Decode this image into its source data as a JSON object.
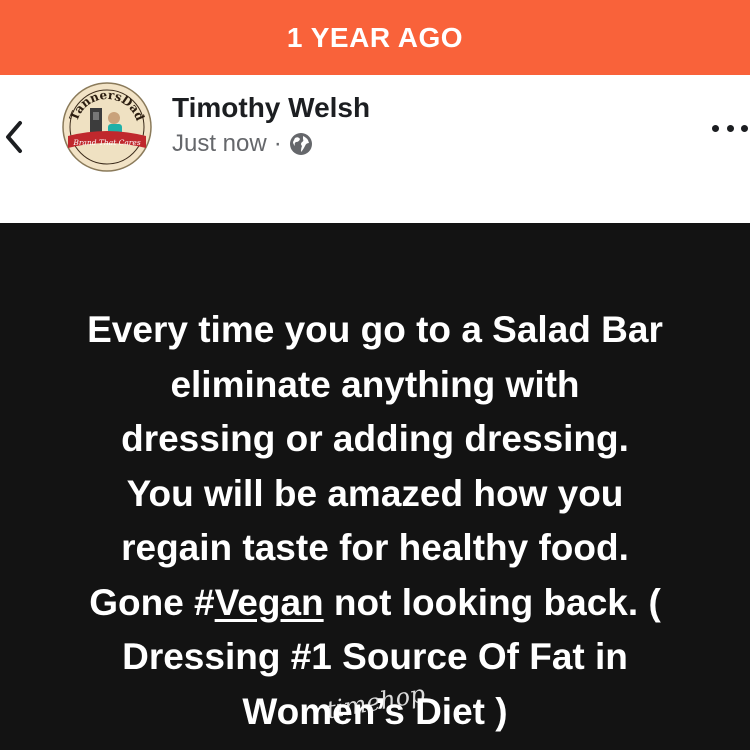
{
  "banner": {
    "label": "1 YEAR AGO",
    "color": "#f9623a"
  },
  "header": {
    "back_icon": "chevron-left-icon",
    "avatar": {
      "icon": "page-avatar",
      "top_text": "TannersDad",
      "bottom_text": "The Brand That Cares"
    },
    "author_name": "Timothy Welsh",
    "timestamp": "Just now",
    "separator": "·",
    "privacy_icon": "globe-icon",
    "more_icon": "more-horizontal-icon"
  },
  "post": {
    "background": "#131313",
    "lines_before_hashtag": [
      "Every time you go to a Salad Bar",
      "eliminate anything with",
      "dressing or adding dressing.",
      "You will be amazed how you",
      "regain taste for healthy food."
    ],
    "hashtag_line_prefix": "Gone #",
    "hashtag": "Vegan",
    "hashtag_line_suffix": " not looking back. (",
    "lines_after_hashtag": [
      "Dressing #1 Source Of Fat in",
      "Women’s Diet )"
    ]
  },
  "watermark": "timehop"
}
